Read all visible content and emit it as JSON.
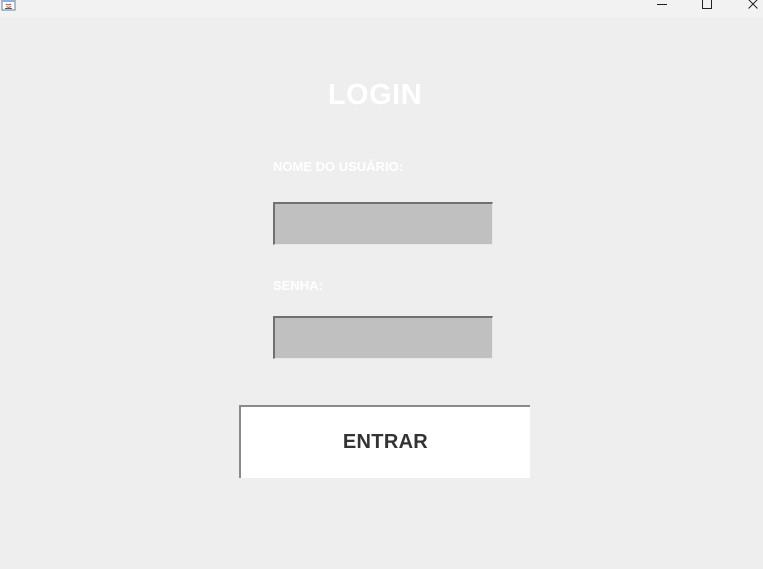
{
  "window": {
    "icon": "java-app-icon",
    "controls": {
      "minimize_icon": "minimize-icon",
      "maximize_icon": "maximize-icon",
      "close_icon": "close-icon"
    }
  },
  "login": {
    "title": "LOGIN",
    "username_label": "NOME DO USUÁRIO:",
    "username_value": "",
    "password_label": "SENHA:",
    "password_value": "",
    "submit_label": "ENTRAR"
  },
  "colors": {
    "background": "#eeeeee",
    "label_text": "#ffffff",
    "field_fill": "#c0c0c0",
    "button_fill": "#ffffff",
    "button_text": "#333333"
  }
}
